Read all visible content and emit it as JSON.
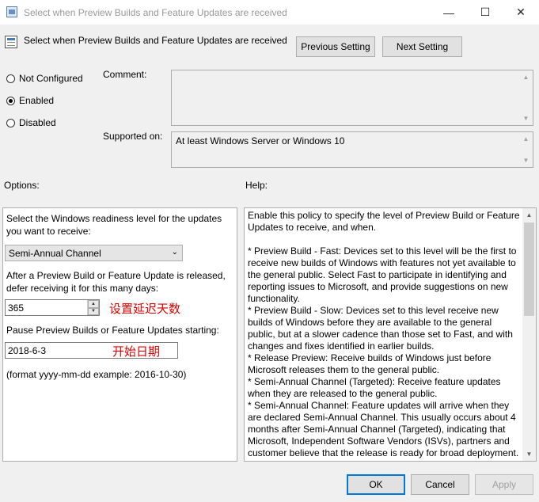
{
  "window": {
    "title": "Select when Preview Builds and Feature Updates are received"
  },
  "header": {
    "title": "Select when Preview Builds and Feature Updates are received",
    "previous_label": "Previous Setting",
    "next_label": "Next Setting"
  },
  "state": {
    "not_configured": "Not Configured",
    "enabled": "Enabled",
    "disabled": "Disabled",
    "selected": "enabled"
  },
  "comment": {
    "label": "Comment:",
    "value": ""
  },
  "supported": {
    "label": "Supported on:",
    "value": "At least Windows Server or Windows 10"
  },
  "options": {
    "label": "Options:",
    "readiness_label": "Select the Windows readiness level for the updates you want to receive:",
    "readiness_value": "Semi-Annual Channel",
    "defer_label": "After a Preview Build or Feature Update is released, defer receiving it for this many days:",
    "defer_value": "365",
    "defer_annotation": "设置延迟天数",
    "pause_label": "Pause Preview Builds or Feature Updates starting:",
    "pause_value": "2018-6-3",
    "pause_annotation": "开始日期",
    "format_note": "(format yyyy-mm-dd example: 2016-10-30)"
  },
  "help": {
    "label": "Help:",
    "text": "Enable this policy to specify the level of Preview Build or Feature Updates to receive, and when.\n\n* Preview Build - Fast: Devices set to this level will be the first to receive new builds of Windows with features not yet available to the general public. Select Fast to participate in identifying and reporting issues to Microsoft, and provide suggestions on new functionality.\n* Preview Build - Slow: Devices set to this level receive new builds of Windows before they are available to the general public, but at a slower cadence than those set to Fast, and with changes and fixes identified in earlier builds.\n* Release Preview: Receive builds of Windows just before Microsoft releases them to the general public.\n* Semi-Annual Channel (Targeted): Receive feature updates when they are released to the general public.\n* Semi-Annual Channel: Feature updates will arrive when they are declared Semi-Annual Channel. This usually occurs about 4 months after Semi-Annual Channel (Targeted), indicating that Microsoft, Independent Software Vendors (ISVs), partners and customer believe that the release is ready for broad deployment."
  },
  "footer": {
    "ok": "OK",
    "cancel": "Cancel",
    "apply": "Apply"
  }
}
